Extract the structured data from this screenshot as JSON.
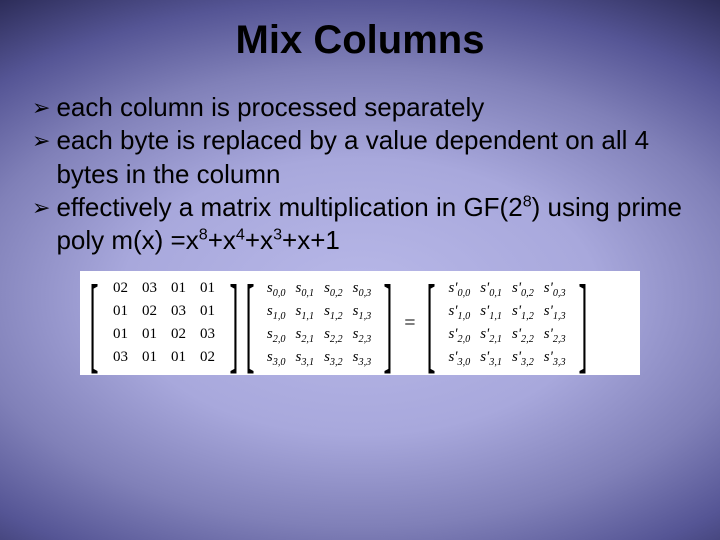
{
  "title": "Mix Columns",
  "bullets": [
    "each column is processed separately",
    "each byte is replaced by a value dependent on all 4 bytes in the column",
    "effectively a matrix multiplication in GF(2⁸) using prime poly m(x) =x⁸+x⁴+x³+x+1"
  ],
  "equation": {
    "coeff": [
      [
        "02",
        "03",
        "01",
        "01"
      ],
      [
        "01",
        "02",
        "03",
        "01"
      ],
      [
        "01",
        "01",
        "02",
        "03"
      ],
      [
        "03",
        "01",
        "01",
        "02"
      ]
    ],
    "state_in": [
      [
        "s0,0",
        "s0,1",
        "s0,2",
        "s0,3"
      ],
      [
        "s1,0",
        "s1,1",
        "s1,2",
        "s1,3"
      ],
      [
        "s2,0",
        "s2,1",
        "s2,2",
        "s2,3"
      ],
      [
        "s3,0",
        "s3,1",
        "s3,2",
        "s3,3"
      ]
    ],
    "state_out": [
      [
        "s'0,0",
        "s'0,1",
        "s'0,2",
        "s'0,3"
      ],
      [
        "s'1,0",
        "s'1,1",
        "s'1,2",
        "s'1,3"
      ],
      [
        "s'2,0",
        "s'2,1",
        "s'2,2",
        "s'2,3"
      ],
      [
        "s'3,0",
        "s'3,1",
        "s'3,2",
        "s'3,3"
      ]
    ],
    "op": "="
  }
}
